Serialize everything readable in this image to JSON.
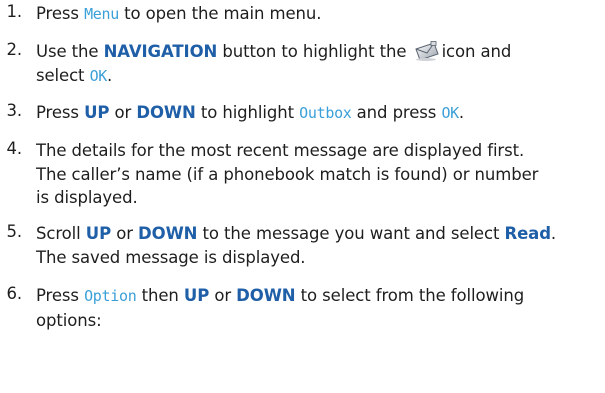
{
  "steps": [
    {
      "num": "1.",
      "p1": "Press ",
      "k1": "Menu",
      "p2": " to open the main menu."
    },
    {
      "num": "2.",
      "p1": "Use the ",
      "b1": "NAVIGATION",
      "p2": " button to highlight the",
      "p3": "icon and",
      "p4": "select ",
      "k1": "OK",
      "p5": "."
    },
    {
      "num": "3.",
      "p1": "Press ",
      "b1": "UP",
      "p2": " or ",
      "b2": "DOWN",
      "p3": " to highlight ",
      "k1": "Outbox",
      "p4": " and press ",
      "k2": "OK",
      "p5": "."
    },
    {
      "num": "4.",
      "l1": "The details for the most recent message are displayed first.",
      "l2": "The caller’s name (if a phonebook match is found) or number",
      "l3": "is displayed."
    },
    {
      "num": "5.",
      "p1": "Scroll ",
      "b1": "UP",
      "p2": " or ",
      "b2": "DOWN",
      "p3": " to the message you want and select ",
      "b3": "Read",
      "p4": ".",
      "l2": "The saved message is displayed."
    },
    {
      "num": "6.",
      "p1": "Press ",
      "k1": "Option",
      "p2": " then ",
      "b1": "UP",
      "p3": " or ",
      "b2": "DOWN",
      "p4": " to select from the following",
      "l2": "options:"
    }
  ],
  "icons": {
    "messages": "envelope-icon"
  }
}
